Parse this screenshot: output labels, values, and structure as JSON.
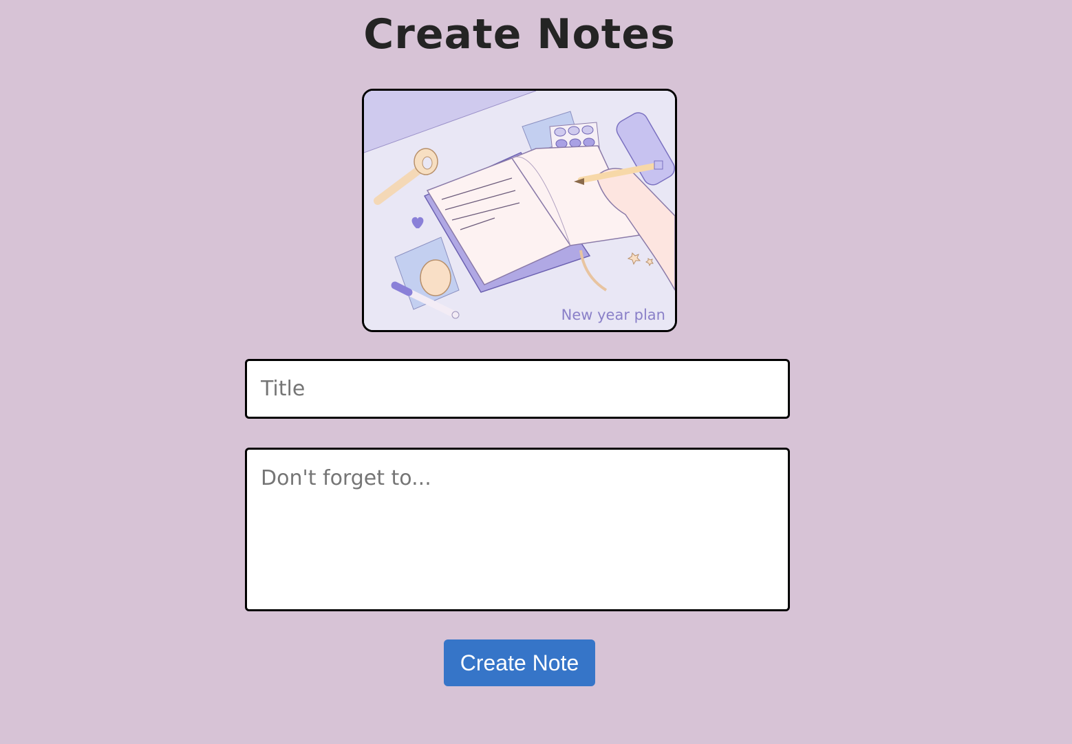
{
  "header": {
    "title": "Create Notes"
  },
  "illustration": {
    "caption": "New year plan"
  },
  "form": {
    "title_placeholder": "Title",
    "content_placeholder": "Don't forget to...",
    "title_value": "",
    "content_value": "",
    "submit_label": "Create Note"
  },
  "colors": {
    "background": "#d7c3d6",
    "button": "#3675c8",
    "heading": "#242424"
  }
}
